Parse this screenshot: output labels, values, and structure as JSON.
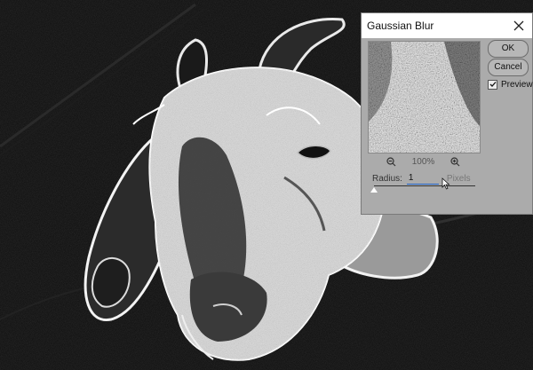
{
  "dialog": {
    "title": "Gaussian Blur",
    "ok_label": "OK",
    "cancel_label": "Cancel",
    "preview_label": "Preview",
    "preview_checked": true,
    "zoom_level": "100%",
    "radius_label": "Radius:",
    "radius_value": "1",
    "radius_unit": "Pixels",
    "radius_fraction": 0.0
  },
  "icons": {
    "close": "close-icon",
    "zoom_out": "zoom-out-icon",
    "zoom_in": "zoom-in-icon",
    "checkmark": "checkmark-icon"
  },
  "colors": {
    "dialog_bg": "#ababab",
    "titlebar_bg": "#ffffff",
    "focus_accent": "#2266cc"
  }
}
